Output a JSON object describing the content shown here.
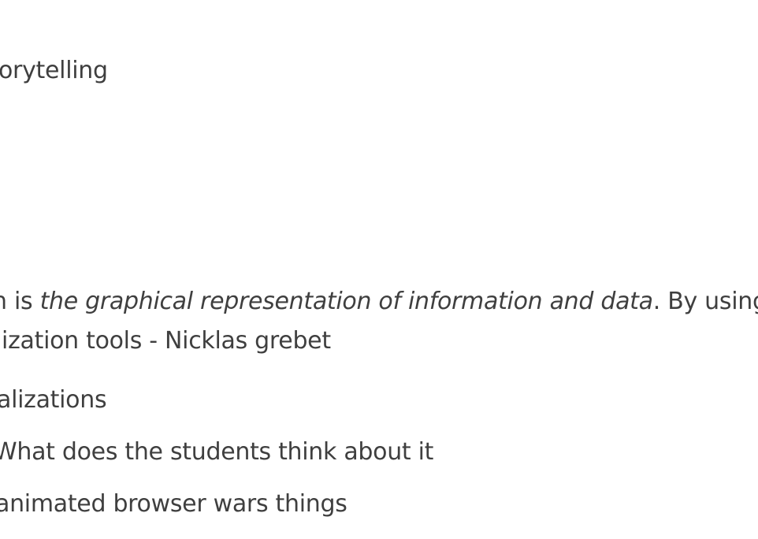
{
  "document": {
    "heading_fragment": "orytelling",
    "definition": {
      "prefix": "n is ",
      "emphasis": "the graphical representation of information and data",
      "suffix": ". By using v"
    },
    "tools_line": "lization tools - Nicklas grebet",
    "visualizations_line": "alizations",
    "students_line": "What does the students think about it",
    "browser_wars_line": "animated browser wars things"
  }
}
